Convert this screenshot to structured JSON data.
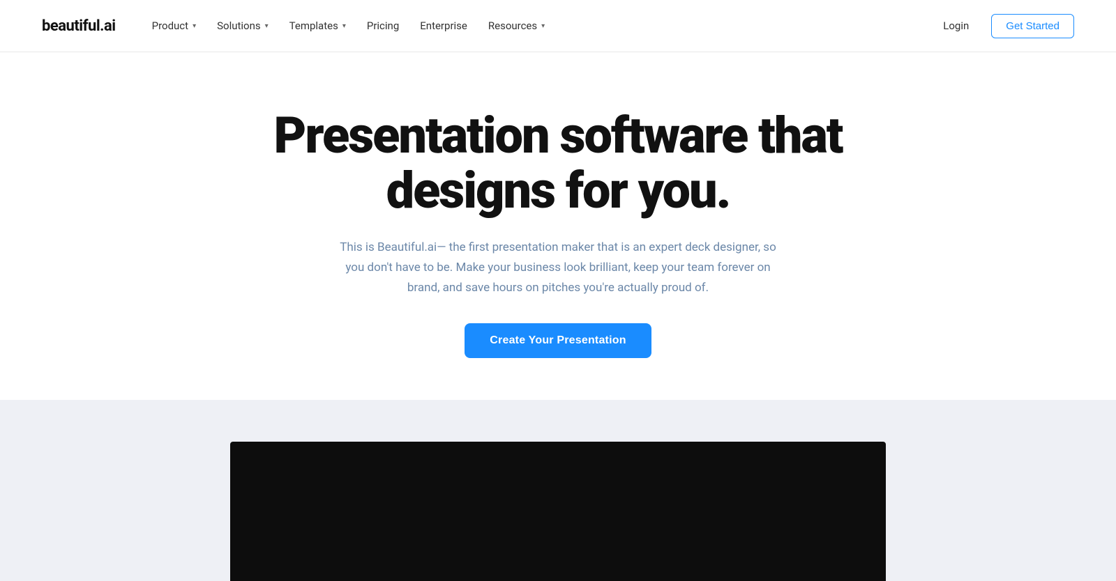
{
  "brand": {
    "logo": "beautiful.ai"
  },
  "navbar": {
    "items": [
      {
        "label": "Product",
        "has_dropdown": true
      },
      {
        "label": "Solutions",
        "has_dropdown": true
      },
      {
        "label": "Templates",
        "has_dropdown": true
      },
      {
        "label": "Pricing",
        "has_dropdown": false
      },
      {
        "label": "Enterprise",
        "has_dropdown": false
      },
      {
        "label": "Resources",
        "has_dropdown": true
      }
    ],
    "login_label": "Login",
    "get_started_label": "Get Started"
  },
  "hero": {
    "title_line1": "Presentation software that",
    "title_line2": "designs for you.",
    "subtitle": "This is Beautiful.ai— the first presentation maker that is an expert deck designer, so you don't have to be. Make your business look brilliant, keep your team forever on brand, and save hours on pitches you're actually proud of.",
    "cta_label": "Create Your Presentation"
  },
  "colors": {
    "accent_blue": "#1a8cff",
    "subtitle_blue": "#6b87a8",
    "border": "#e8e8e8",
    "gray_bg": "#eef0f5"
  }
}
